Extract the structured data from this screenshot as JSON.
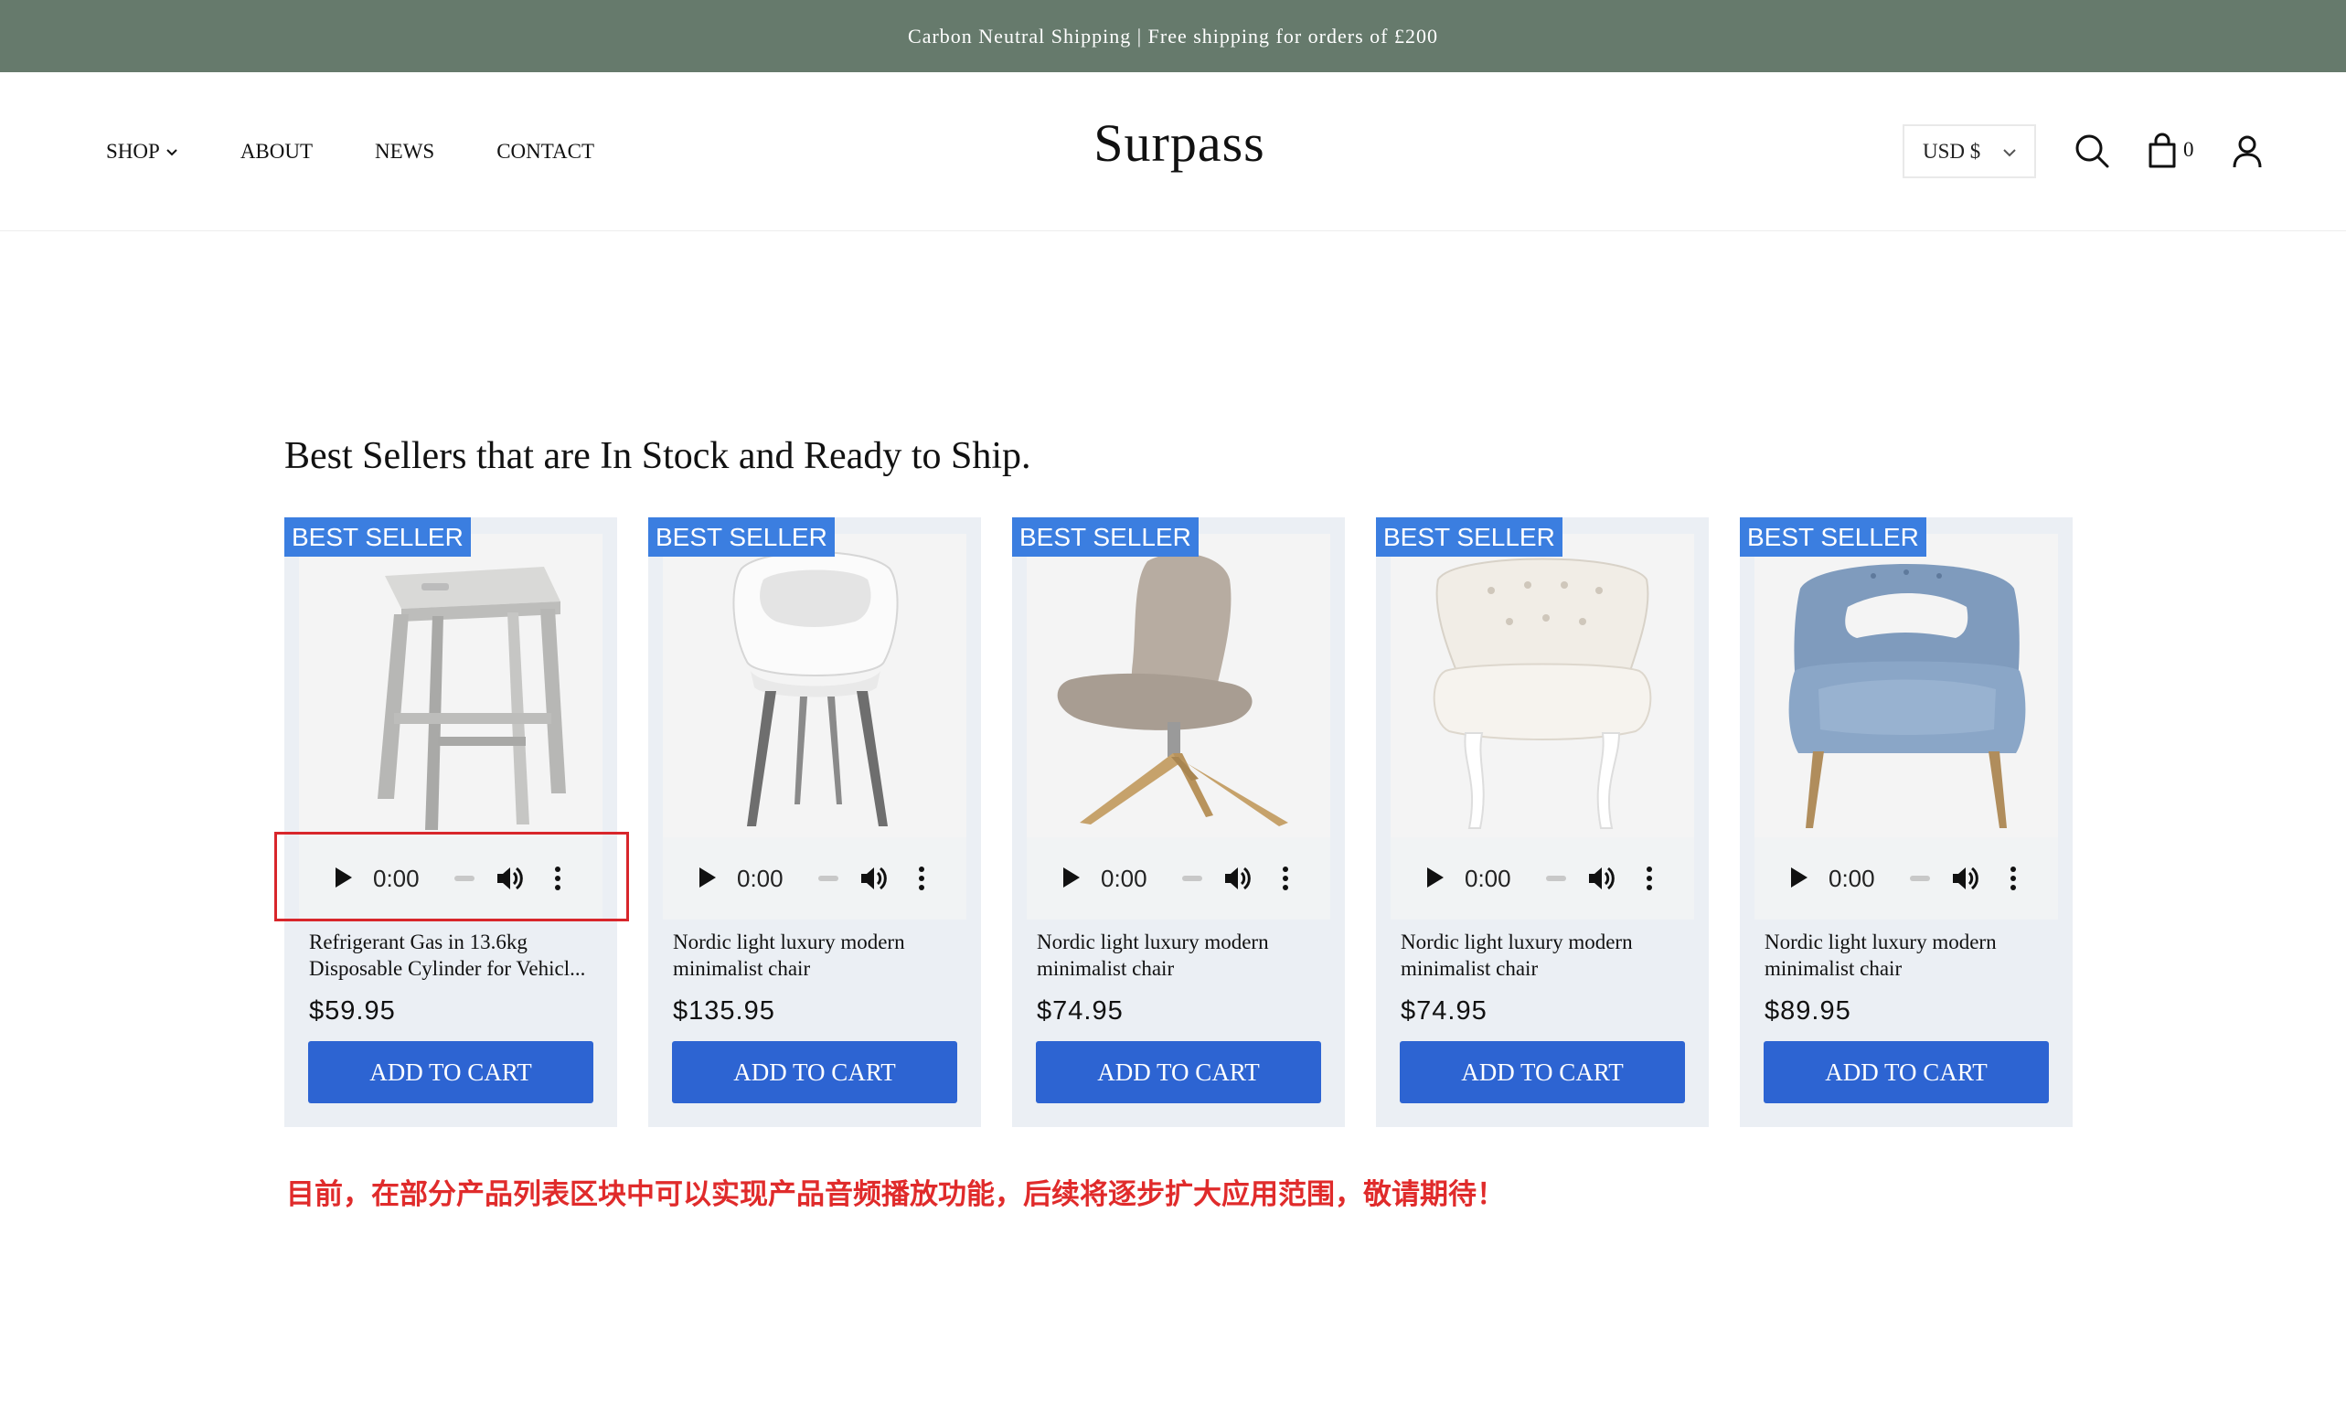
{
  "announcement": "Carbon Neutral Shipping | Free shipping for orders of £200",
  "nav": {
    "items": [
      {
        "label": "SHOP",
        "has_dropdown": true
      },
      {
        "label": "ABOUT"
      },
      {
        "label": "NEWS"
      },
      {
        "label": "CONTACT"
      }
    ]
  },
  "logo": "Surpass",
  "header": {
    "currency": "USD $",
    "cart_count": "0",
    "icons": [
      "search-icon",
      "cart-icon",
      "account-icon"
    ]
  },
  "section_title": "Best Sellers that are In Stock and Ready to Ship.",
  "products": [
    {
      "badge": "BEST SELLER",
      "title": "Refrigerant Gas in 13.6kg\nDisposable Cylinder for Vehicl...",
      "price": "$59.95",
      "time": "0:00",
      "button": "ADD TO CART"
    },
    {
      "badge": "BEST SELLER",
      "title": "Nordic light luxury modern\nminimalist chair",
      "price": "$135.95",
      "time": "0:00",
      "button": "ADD TO CART"
    },
    {
      "badge": "BEST SELLER",
      "title": "Nordic light luxury modern\nminimalist chair",
      "price": "$74.95",
      "time": "0:00",
      "button": "ADD TO CART"
    },
    {
      "badge": "BEST SELLER",
      "title": "Nordic light luxury modern\nminimalist chair",
      "price": "$74.95",
      "time": "0:00",
      "button": "ADD TO CART"
    },
    {
      "badge": "BEST SELLER",
      "title": "Nordic light luxury modern\nminimalist chair",
      "price": "$89.95",
      "time": "0:00",
      "button": "ADD TO CART"
    }
  ],
  "notice": "目前，在部分产品列表区块中可以实现产品音频播放功能，后续将逐步扩大应用范围，敬请期待！",
  "colors": {
    "announcement_bg": "#667a6c",
    "badge_bg": "#3b7ee0",
    "button_bg": "#2d64d2",
    "card_bg": "#ebeff4",
    "notice_text": "#e02b2b",
    "highlight_border": "#d8262b"
  }
}
